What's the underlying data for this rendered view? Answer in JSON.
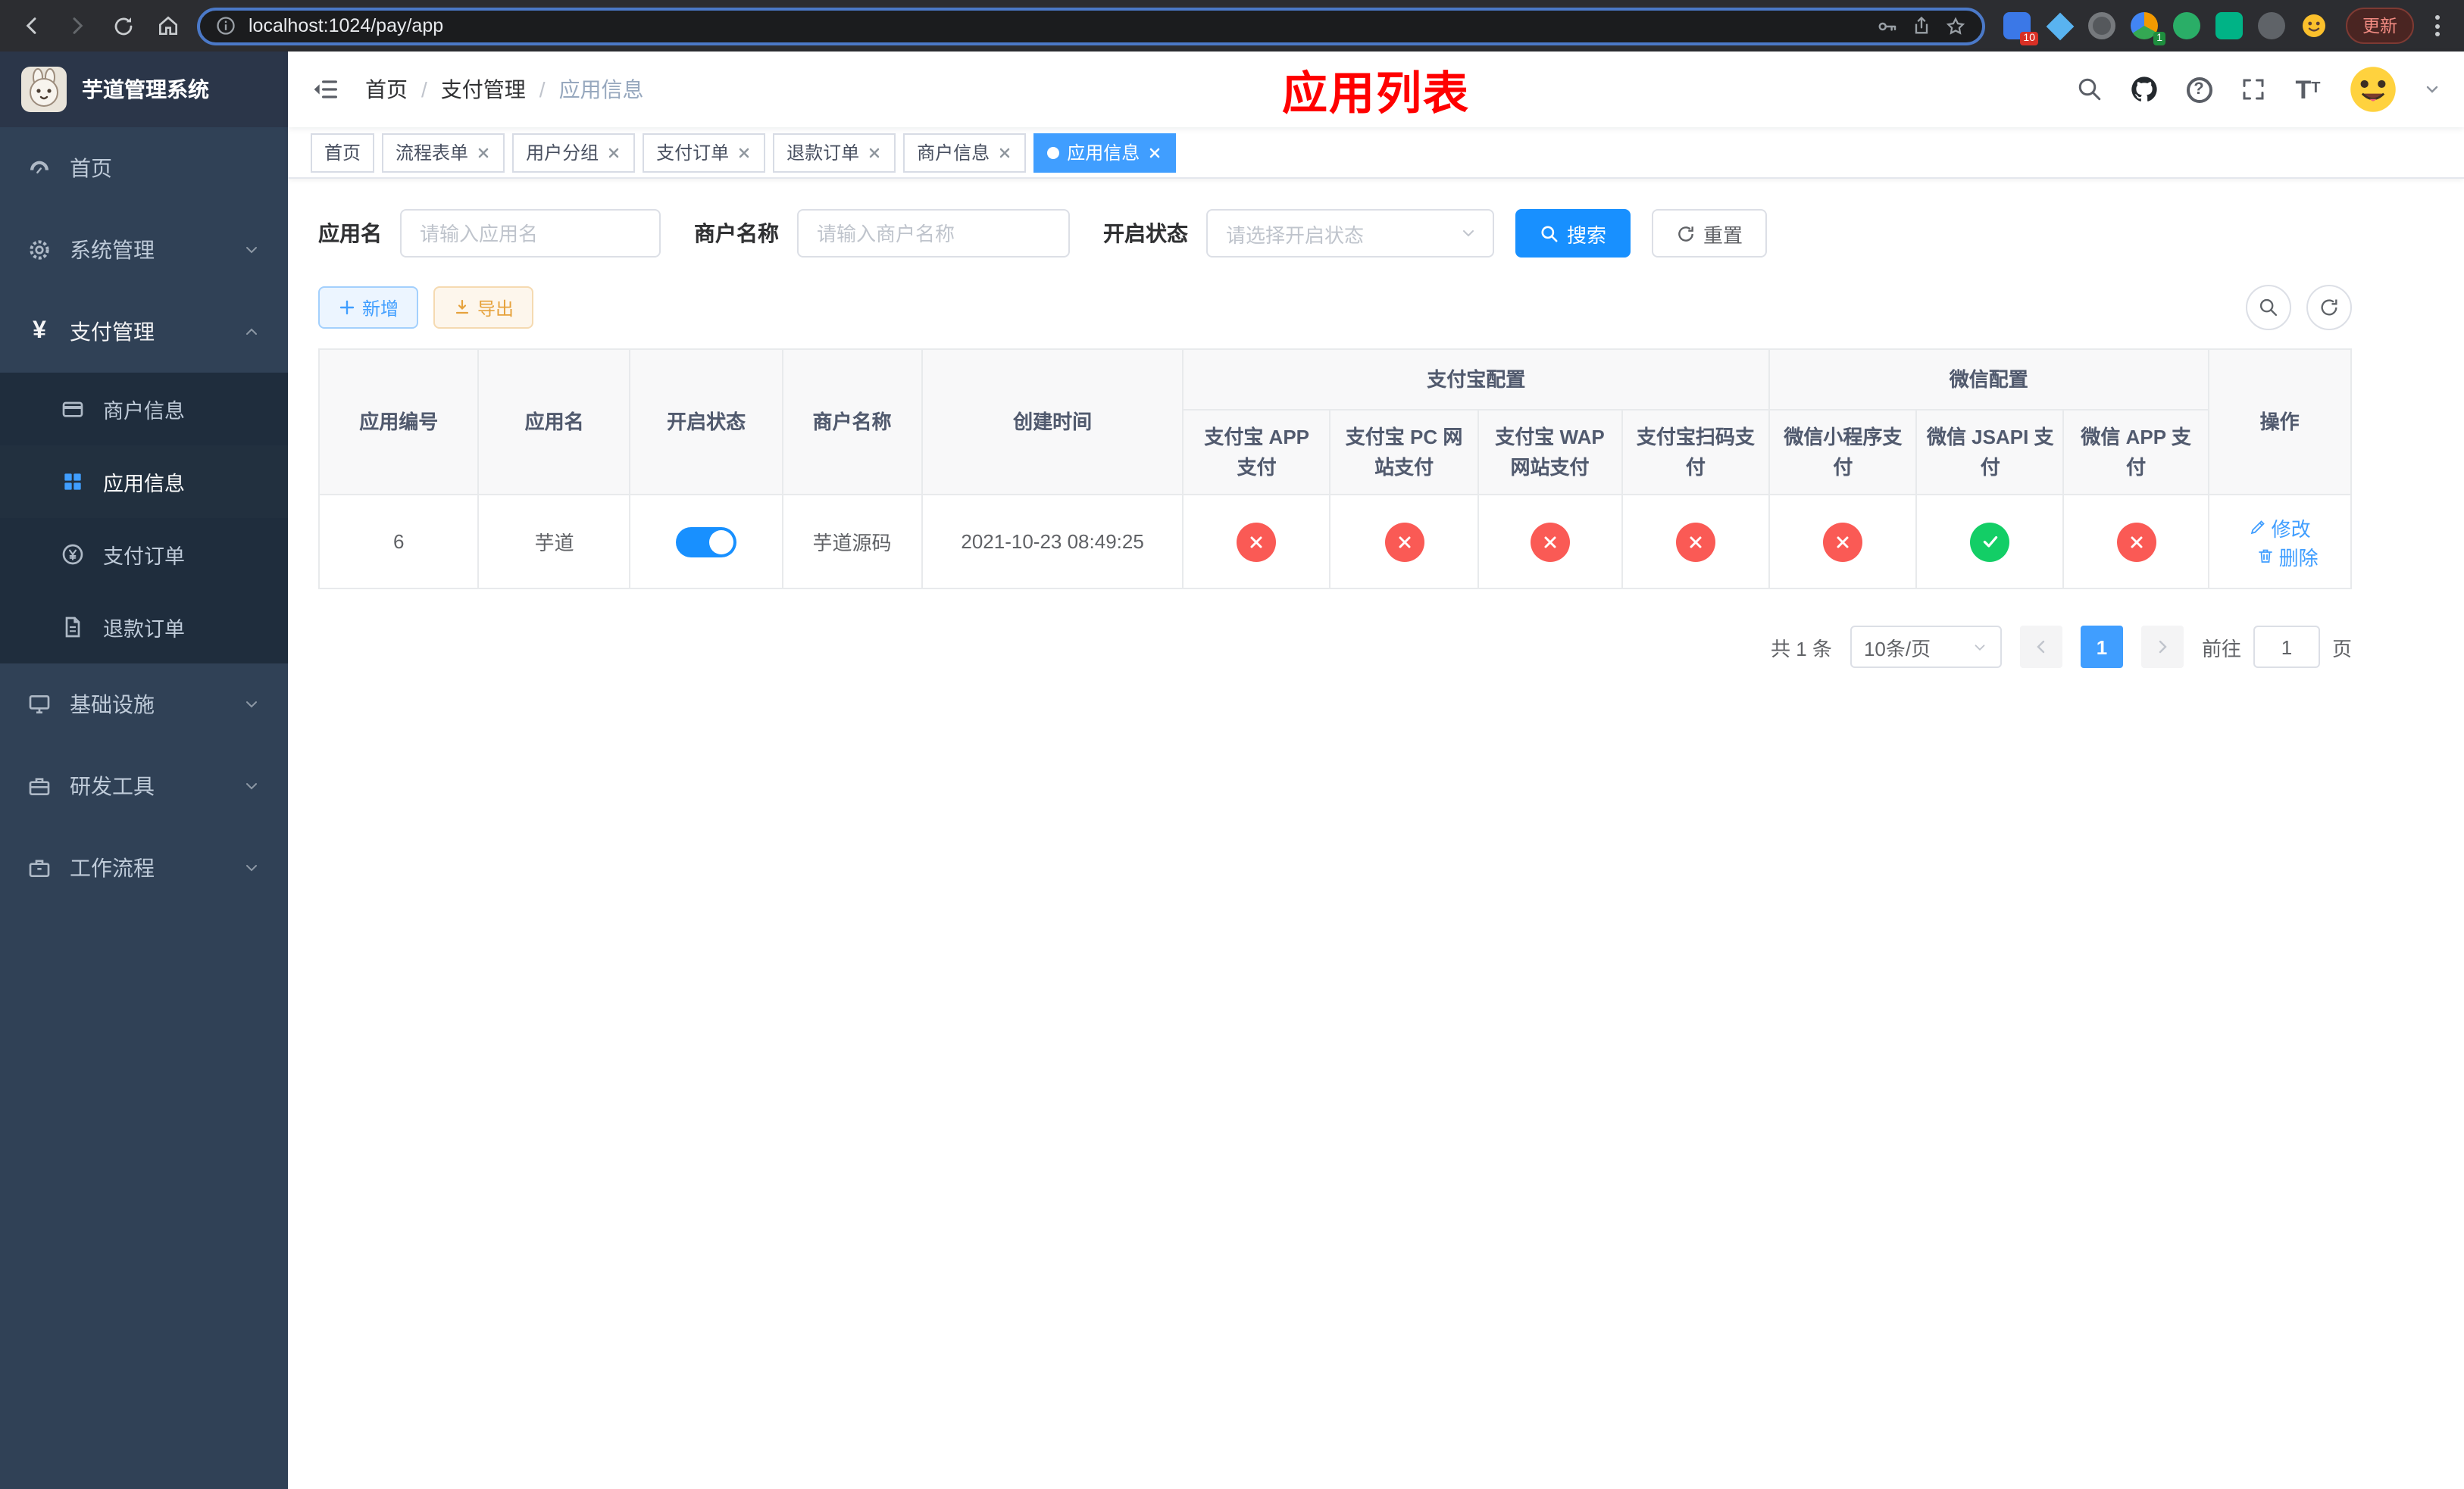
{
  "colors": {
    "primary": "#409eff",
    "primary_strong": "#1890ff",
    "success": "#13ce66",
    "danger": "#fa5a55",
    "warning": "#e6a23c",
    "page_title_red": "#ff0000"
  },
  "icons": {
    "yen_glyph": "¥",
    "question_glyph": "?",
    "font_large_glyph": "T",
    "font_small_glyph": "T"
  },
  "browser": {
    "url": "localhost:1024/pay/app",
    "update_label": "更新",
    "extension_badge_10": "10",
    "extension_badge_1": "1"
  },
  "sidebar": {
    "logo_title": "芋道管理系统",
    "items": {
      "home": "首页",
      "system": "系统管理",
      "pay": "支付管理",
      "merchant": "商户信息",
      "app": "应用信息",
      "order": "支付订单",
      "refund": "退款订单",
      "infra": "基础设施",
      "devtools": "研发工具",
      "workflow": "工作流程"
    }
  },
  "header": {
    "breadcrumb": [
      "首页",
      "支付管理",
      "应用信息"
    ],
    "page_title": "应用列表"
  },
  "tabs": [
    {
      "label": "首页"
    },
    {
      "label": "流程表单"
    },
    {
      "label": "用户分组"
    },
    {
      "label": "支付订单"
    },
    {
      "label": "退款订单"
    },
    {
      "label": "商户信息"
    },
    {
      "label": "应用信息"
    }
  ],
  "filters": {
    "app_name_label": "应用名",
    "app_name_placeholder": "请输入应用名",
    "merchant_label": "商户名称",
    "merchant_placeholder": "请输入商户名称",
    "status_label": "开启状态",
    "status_placeholder": "请选择开启状态",
    "search_label": "搜索",
    "reset_label": "重置"
  },
  "toolbar": {
    "add_label": "新增",
    "export_label": "导出"
  },
  "table": {
    "headers": {
      "app_id": "应用编号",
      "app_name": "应用名",
      "status": "开启状态",
      "merchant": "商户名称",
      "created": "创建时间",
      "alipay_group": "支付宝配置",
      "wechat_group": "微信配置",
      "alipay_app": "支付宝 APP 支付",
      "alipay_pc": "支付宝 PC 网站支付",
      "alipay_wap": "支付宝 WAP 网站支付",
      "alipay_qr": "支付宝扫码支付",
      "wx_mini": "微信小程序支付",
      "wx_jsapi": "微信 JSAPI 支付",
      "wx_app": "微信 APP 支付",
      "actions": "操作"
    },
    "row": {
      "app_id": "6",
      "app_name": "芋道",
      "enabled": true,
      "merchant": "芋道源码",
      "created": "2021-10-23 08:49:25",
      "alipay_app": false,
      "alipay_pc": false,
      "alipay_wap": false,
      "alipay_qr": false,
      "wx_mini": false,
      "wx_jsapi": true,
      "wx_app": false,
      "edit_label": "修改",
      "delete_label": "删除"
    }
  },
  "pagination": {
    "total_text": "共 1 条",
    "page_size_text": "10条/页",
    "page": "1",
    "goto_label": "前往",
    "goto_value": "1",
    "goto_unit": "页"
  }
}
